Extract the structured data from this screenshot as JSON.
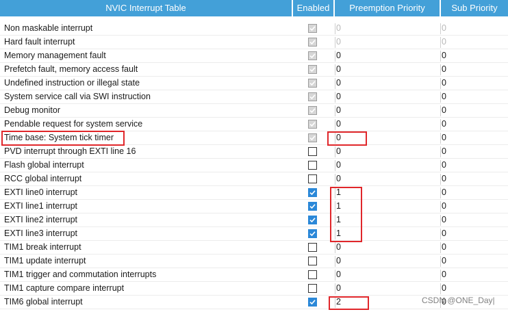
{
  "header": {
    "name": "NVIC Interrupt Table",
    "enabled": "Enabled",
    "preemption": "Preemption Priority",
    "sub": "Sub Priority"
  },
  "rows": [
    {
      "name": "Non maskable interrupt",
      "enabled": "disabled-checked",
      "preemption": "0",
      "sub": "0",
      "preemption_dim": true,
      "sub_dim": true
    },
    {
      "name": "Hard fault interrupt",
      "enabled": "disabled-checked",
      "preemption": "0",
      "sub": "0",
      "preemption_dim": true,
      "sub_dim": true
    },
    {
      "name": "Memory management fault",
      "enabled": "disabled-checked",
      "preemption": "0",
      "sub": "0"
    },
    {
      "name": "Prefetch fault, memory access fault",
      "enabled": "disabled-checked",
      "preemption": "0",
      "sub": "0"
    },
    {
      "name": "Undefined instruction or illegal state",
      "enabled": "disabled-checked",
      "preemption": "0",
      "sub": "0"
    },
    {
      "name": "System service call via SWI instruction",
      "enabled": "disabled-checked",
      "preemption": "0",
      "sub": "0"
    },
    {
      "name": "Debug monitor",
      "enabled": "disabled-checked",
      "preemption": "0",
      "sub": "0"
    },
    {
      "name": "Pendable request for system service",
      "enabled": "disabled-checked",
      "preemption": "0",
      "sub": "0"
    },
    {
      "name": "Time base: System tick timer",
      "enabled": "disabled-checked",
      "preemption": "0",
      "sub": "0"
    },
    {
      "name": "PVD interrupt through EXTI line 16",
      "enabled": "unchecked",
      "preemption": "0",
      "sub": "0"
    },
    {
      "name": "Flash global interrupt",
      "enabled": "unchecked",
      "preemption": "0",
      "sub": "0"
    },
    {
      "name": "RCC global interrupt",
      "enabled": "unchecked",
      "preemption": "0",
      "sub": "0"
    },
    {
      "name": "EXTI line0 interrupt",
      "enabled": "checked",
      "preemption": "1",
      "sub": "0"
    },
    {
      "name": "EXTI line1 interrupt",
      "enabled": "checked",
      "preemption": "1",
      "sub": "0"
    },
    {
      "name": "EXTI line2 interrupt",
      "enabled": "checked",
      "preemption": "1",
      "sub": "0"
    },
    {
      "name": "EXTI line3 interrupt",
      "enabled": "checked",
      "preemption": "1",
      "sub": "0"
    },
    {
      "name": "TIM1 break interrupt",
      "enabled": "unchecked",
      "preemption": "0",
      "sub": "0"
    },
    {
      "name": "TIM1 update interrupt",
      "enabled": "unchecked",
      "preemption": "0",
      "sub": "0"
    },
    {
      "name": "TIM1 trigger and commutation interrupts",
      "enabled": "unchecked",
      "preemption": "0",
      "sub": "0"
    },
    {
      "name": "TIM1 capture compare interrupt",
      "enabled": "unchecked",
      "preemption": "0",
      "sub": "0"
    },
    {
      "name": "TIM6 global interrupt",
      "enabled": "checked",
      "preemption": "2",
      "sub": "0"
    }
  ],
  "watermark": "CSDN @ONE_Day|",
  "colors": {
    "header_bg": "#43a0d8",
    "highlight": "#e0262a",
    "checkbox_on": "#2b88d8"
  }
}
